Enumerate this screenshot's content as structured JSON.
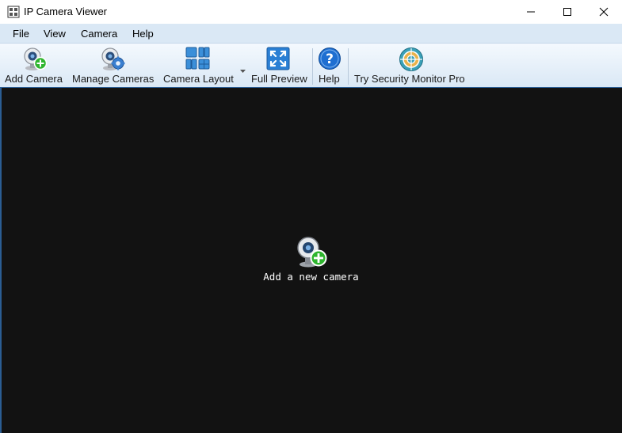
{
  "window": {
    "title": "IP Camera Viewer",
    "icon": "camera-grid-icon",
    "controls": [
      "minimize-icon",
      "maximize-icon",
      "close-icon"
    ]
  },
  "menu": {
    "items": [
      {
        "label": "File"
      },
      {
        "label": "View"
      },
      {
        "label": "Camera"
      },
      {
        "label": "Help"
      }
    ]
  },
  "toolbar": {
    "items": [
      {
        "label": "Add Camera",
        "icon": "webcam-add-icon"
      },
      {
        "label": "Manage Cameras",
        "icon": "webcam-gear-icon"
      },
      {
        "label": "Camera Layout",
        "icon": "grid-layout-icon",
        "dropdown": true
      },
      {
        "label": "Full Preview",
        "icon": "fullscreen-icon"
      },
      {
        "label": "Help",
        "icon": "help-icon"
      },
      {
        "label": "Try Security Monitor Pro",
        "icon": "target-icon"
      }
    ]
  },
  "main": {
    "prompt_label": "Add a new camera",
    "prompt_icon": "webcam-add-icon"
  },
  "colors": {
    "menubar": "#dae8f5",
    "viewport": "#121212",
    "accent": "#2b5d93",
    "add_green": "#2fb52f",
    "help_blue": "#1f6fd1"
  }
}
